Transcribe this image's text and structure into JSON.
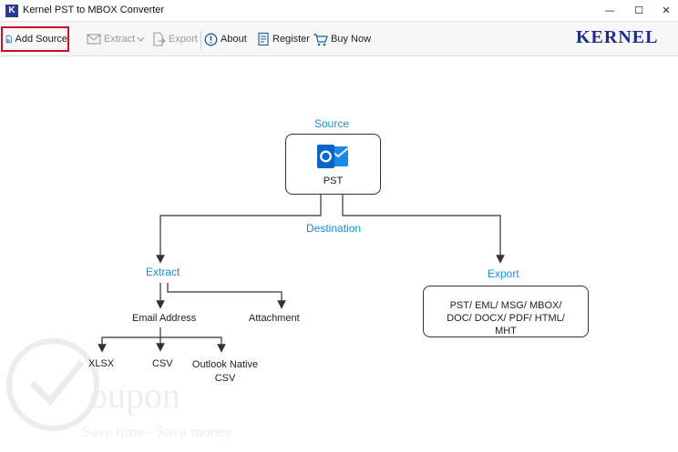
{
  "window": {
    "title": "Kernel PST to MBOX Converter",
    "app_icon_letter": "K",
    "minimize_glyph": "—",
    "maximize_glyph": "☐",
    "close_glyph": "✕"
  },
  "toolbar": {
    "add_source": "Add Source",
    "extract": "Extract",
    "export": "Export",
    "about": "About",
    "register": "Register",
    "buy_now": "Buy Now",
    "logo": "Kernel"
  },
  "diagram": {
    "source": "Source",
    "pst": "PST",
    "destination": "Destination",
    "extract": "Extract",
    "export": "Export",
    "email_address": "Email Address",
    "attachment": "Attachment",
    "formats": "PST/ EML/ MSG/ MBOX/ DOC/ DOCX/ PDF/ HTML/ MHT",
    "xlsx": "XLSX",
    "csv": "CSV",
    "outlook_native_csv": "Outlook Native CSV"
  },
  "watermark": {
    "brand": "oupon",
    "tagline": "Save time - Save money"
  },
  "colors": {
    "accent_blue": "#1a8ed6",
    "brand_navy": "#1e2d8a",
    "highlight_red": "#c8102e"
  }
}
